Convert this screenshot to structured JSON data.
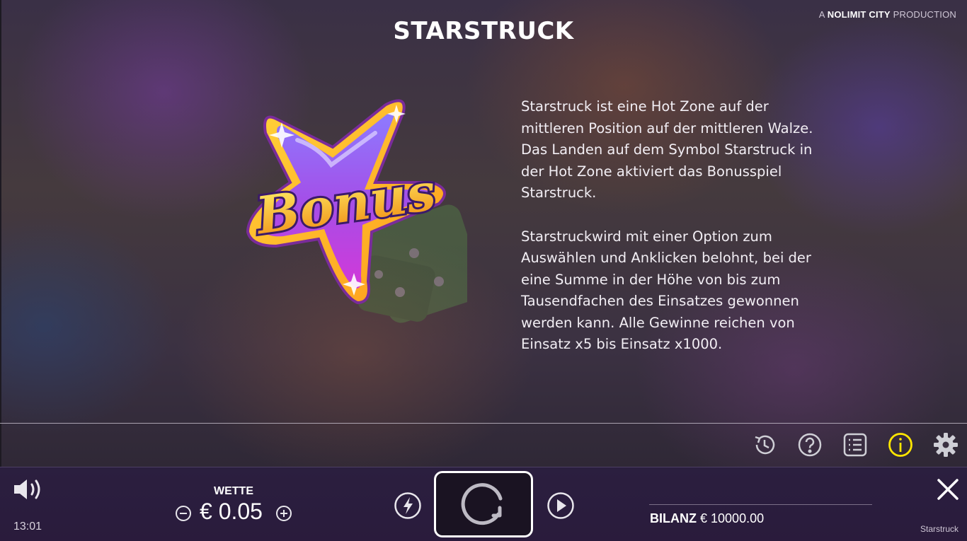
{
  "header": {
    "title": "STARSTRUCK",
    "brand_prefix": "A",
    "brand_name": "NOLIMIT CITY",
    "brand_suffix": "PRODUCTION"
  },
  "illustration": {
    "logo_text": "Bonus",
    "icon": "bonus-star-icon"
  },
  "description": {
    "paragraphs": [
      "Starstruck ist eine Hot Zone auf der mittleren Position auf der mittleren Walze. Das Landen auf dem Symbol Starstruck in der Hot Zone aktiviert das Bonusspiel Starstruck.",
      "Starstruckwird mit einer Option zum Auswählen und Anklicken belohnt, bei der eine Summe in der Höhe von bis zum Tausendfachen des Einsatzes gewonnen werden kann. Alle Gewinne reichen von Einsatz x5 bis Einsatz x1000."
    ]
  },
  "toolbar": {
    "icons": [
      "history-icon",
      "help-icon",
      "paytable-icon",
      "info-icon",
      "settings-icon"
    ],
    "active_color": "#ffe600"
  },
  "bottom_bar": {
    "clock": "13:01",
    "bet_label": "WETTE",
    "bet_value": "€ 0.05",
    "balance_label": "BILANZ",
    "balance_value": "€ 10000.00",
    "game_name": "Starstruck"
  }
}
